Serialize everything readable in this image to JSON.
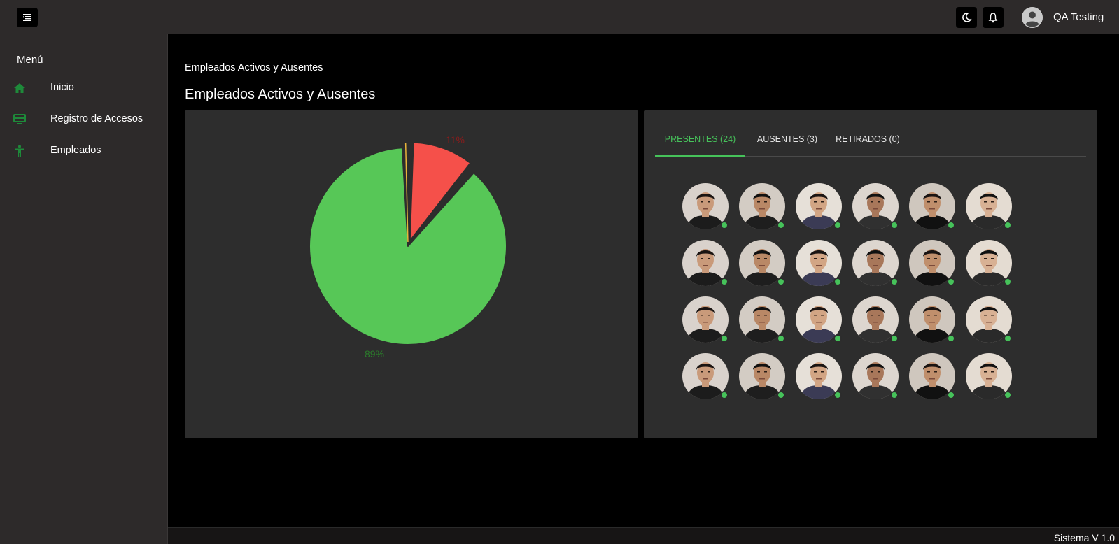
{
  "header": {
    "user_name": "QA Testing",
    "icons": [
      "menu-icon",
      "moon-icon",
      "bell-icon",
      "user-icon"
    ]
  },
  "sidebar": {
    "title": "Menú",
    "items": [
      {
        "label": "Inicio",
        "icon": "home-icon"
      },
      {
        "label": "Registro de Accesos",
        "icon": "monitor-icon"
      },
      {
        "label": "Empleados",
        "icon": "person-icon"
      }
    ],
    "accent": "#1e8a3a"
  },
  "main": {
    "breadcrumb": "Empleados Activos y Ausentes",
    "title": "Empleados Activos y Ausentes"
  },
  "chart_data": {
    "type": "pie",
    "slices": [
      {
        "label": "Presentes",
        "value": 24,
        "percent": "89%",
        "color": "#57c757"
      },
      {
        "label": "Ausentes",
        "value": 3,
        "percent": "11%",
        "color": "#f5504a"
      },
      {
        "label": "Retirados",
        "value": 0.1,
        "percent": "",
        "color": "#e8b43a"
      }
    ],
    "label_colors": {
      "presentes": "#2b7a2b",
      "ausentes": "#8a1c1c"
    }
  },
  "tabs": [
    {
      "label": "PRESENTES (24)",
      "active": true
    },
    {
      "label": "AUSENTES (3)",
      "active": false
    },
    {
      "label": "RETIRADOS (0)",
      "active": false
    }
  ],
  "employees": {
    "count": 24,
    "status": "present",
    "status_color": "#46c25a"
  },
  "footer": {
    "version": "Sistema V 1.0"
  }
}
